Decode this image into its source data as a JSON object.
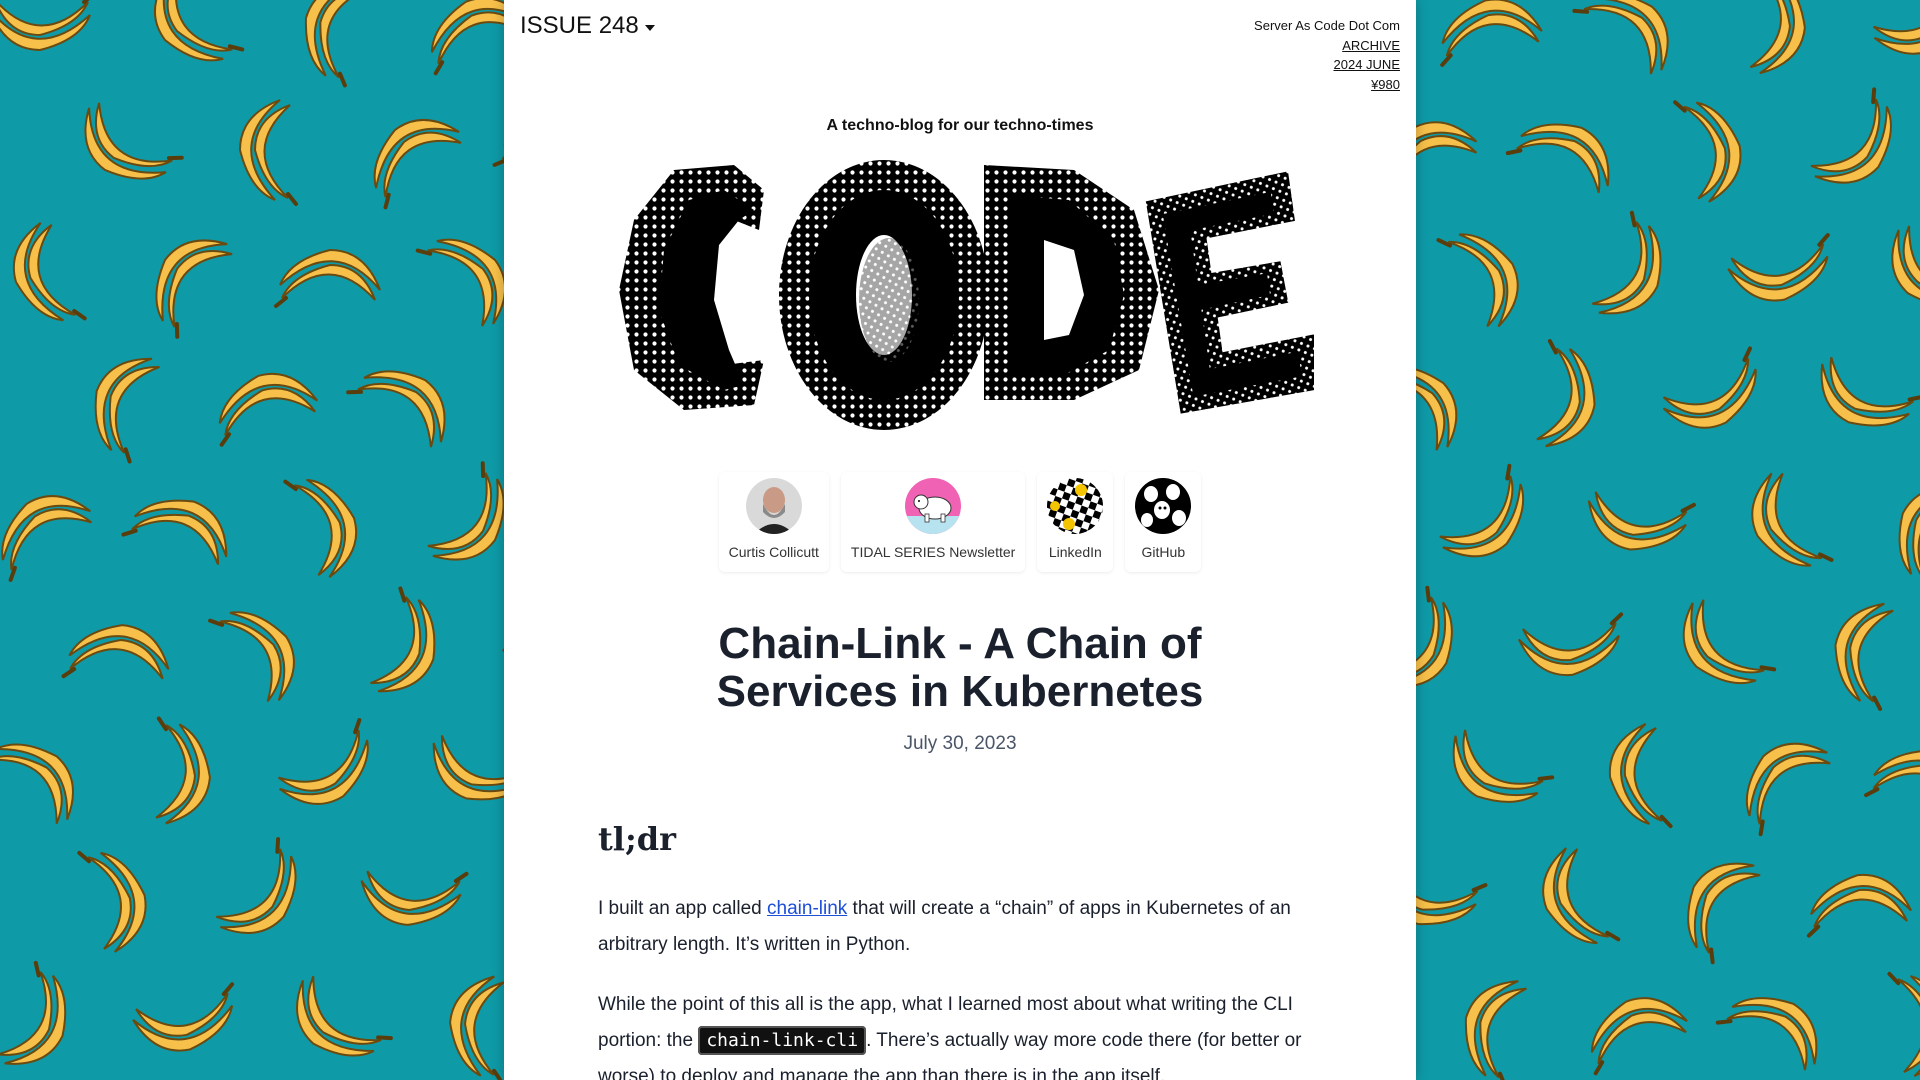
{
  "header": {
    "issue_label": "ISSUE 248",
    "site_name": "Server As Code Dot Com",
    "archive_link": "ARCHIVE",
    "date_link": "2024 JUNE",
    "price_link": "¥980"
  },
  "tagline": "A techno-blog for our techno-times",
  "logo_text": "CODE",
  "links": [
    {
      "label": "Curtis Collicutt",
      "icon": "person-avatar"
    },
    {
      "label": "TIDAL SERIES Newsletter",
      "icon": "polar-bear-avatar"
    },
    {
      "label": "LinkedIn",
      "icon": "checker-smiley-avatar"
    },
    {
      "label": "GitHub",
      "icon": "ghost-pattern-avatar"
    }
  ],
  "article": {
    "title": "Chain-Link - A Chain of Services in Kubernetes",
    "date": "July 30, 2023",
    "section_heading": "tl;dr",
    "p1_before": "I built an app called ",
    "p1_link": "chain-link",
    "p1_after": " that will create a “chain” of apps in Kubernetes of an arbitrary length. It’s written in Python.",
    "p2_before": "While the point of this all is the app, what I learned most about what writing the CLI portion: the ",
    "p2_code": "chain-link-cli",
    "p2_after": ". There’s actually way more code there (for better or worse) to deploy and manage the app than there is in the app itself."
  },
  "colors": {
    "background": "#0e9aa7",
    "banana": "#f7c04a",
    "link": "#1d4ed8"
  }
}
